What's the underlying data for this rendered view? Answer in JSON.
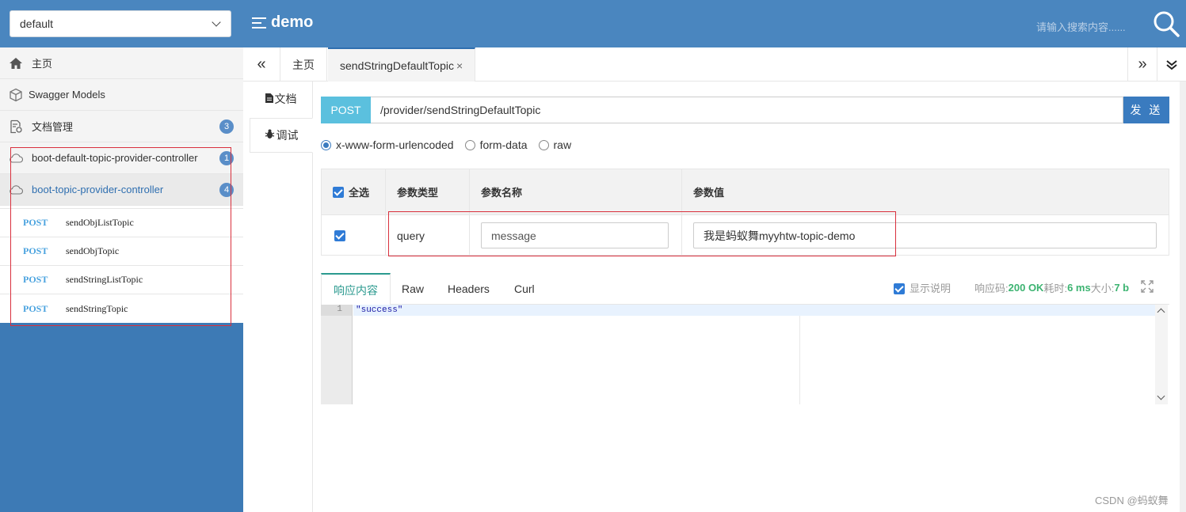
{
  "header": {
    "group_select": "default",
    "title": "demo",
    "search_placeholder": "请输入搜索内容......"
  },
  "sidebar": {
    "items": [
      {
        "label": "主页",
        "icon": "home-icon"
      },
      {
        "label": "Swagger Models",
        "icon": "cube-icon"
      },
      {
        "label": "文档管理",
        "icon": "doc-settings-icon",
        "badge": "3"
      }
    ],
    "controllers": [
      {
        "label": "boot-default-topic-provider-controller",
        "badge": "1"
      },
      {
        "label": "boot-topic-provider-controller",
        "badge": "4"
      }
    ],
    "apis": [
      {
        "method": "POST",
        "name": "sendObjListTopic"
      },
      {
        "method": "POST",
        "name": "sendObjTopic"
      },
      {
        "method": "POST",
        "name": "sendStringListTopic"
      },
      {
        "method": "POST",
        "name": "sendStringTopic"
      }
    ]
  },
  "tabs": {
    "home": "主页",
    "current": "sendStringDefaultTopic",
    "close": "×"
  },
  "subtabs": {
    "doc": "文档",
    "debug": "调试"
  },
  "request": {
    "method": "POST",
    "url": "/provider/sendStringDefaultTopic",
    "send": "发 送",
    "content_types": [
      "x-www-form-urlencoded",
      "form-data",
      "raw"
    ],
    "selected_content_type": "x-www-form-urlencoded"
  },
  "params": {
    "headers": [
      "全选",
      "参数类型",
      "参数名称",
      "参数值"
    ],
    "rows": [
      {
        "type": "query",
        "name": "message",
        "value": "我是蚂蚁舞myyhtw-topic-demo"
      }
    ]
  },
  "response": {
    "tabs": [
      "响应内容",
      "Raw",
      "Headers",
      "Curl"
    ],
    "show_desc": "显示说明",
    "code_label": "响应码:",
    "code_value": "200 OK",
    "time_label": "耗时:",
    "time_value": "6 ms",
    "size_label": "大小:",
    "size_value": "7 b",
    "line_number": "1",
    "body": "\"success\""
  },
  "watermark": "CSDN @蚂蚁舞",
  "colors": {
    "header": "#4a86bf",
    "sidebar": "#3d7ab5",
    "accent": "#2b9a8f",
    "method": "#5bc0de",
    "send": "#3a7bbf",
    "highlight_box": "#d9303d"
  }
}
